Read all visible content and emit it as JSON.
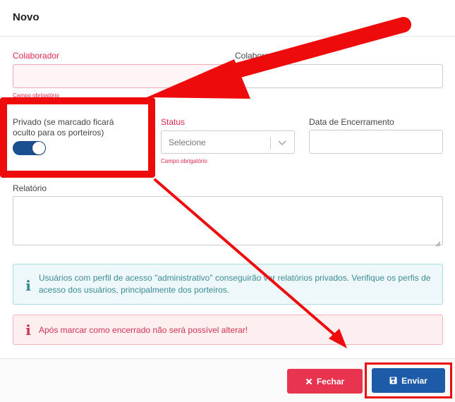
{
  "modal": {
    "title": "Novo"
  },
  "form": {
    "colaborador_label": "Colaborador",
    "colaborador_value": "",
    "colaborador_error": "Campo obrigatório",
    "colaborador2_label": "Colaborador prévio",
    "colaborador2_value": "",
    "privado_label": "Privado (se marcado ficará oculto para os porteiros)",
    "privado_on": true,
    "status_label": "Status",
    "status_placeholder": "Selecione",
    "status_error": "Campo obrigatório",
    "data_encerramento_label": "Data de Encerramento",
    "data_encerramento_value": "",
    "relatorio_label": "Relatório",
    "relatorio_value": ""
  },
  "alerts": {
    "info_text": "Usuários com perfil de acesso \"administrativo\" conseguirão ver relatórios privados. Verifique os perfis de acesso dos usuários, principalmente dos porteiros.",
    "danger_text": "Após marcar como encerrado não será possível alterar!"
  },
  "footer": {
    "fechar_label": "Fechar",
    "enviar_label": "Enviar"
  },
  "icons": {
    "info": "info-icon",
    "danger": "exclamation-icon",
    "fechar": "times-icon",
    "enviar": "save-icon",
    "select": "chevron-down-icon"
  },
  "colors": {
    "error": "#e0284e",
    "primary": "#1d5ba8",
    "danger_button": "#e8344f",
    "annotation": "#ee0b0b"
  }
}
